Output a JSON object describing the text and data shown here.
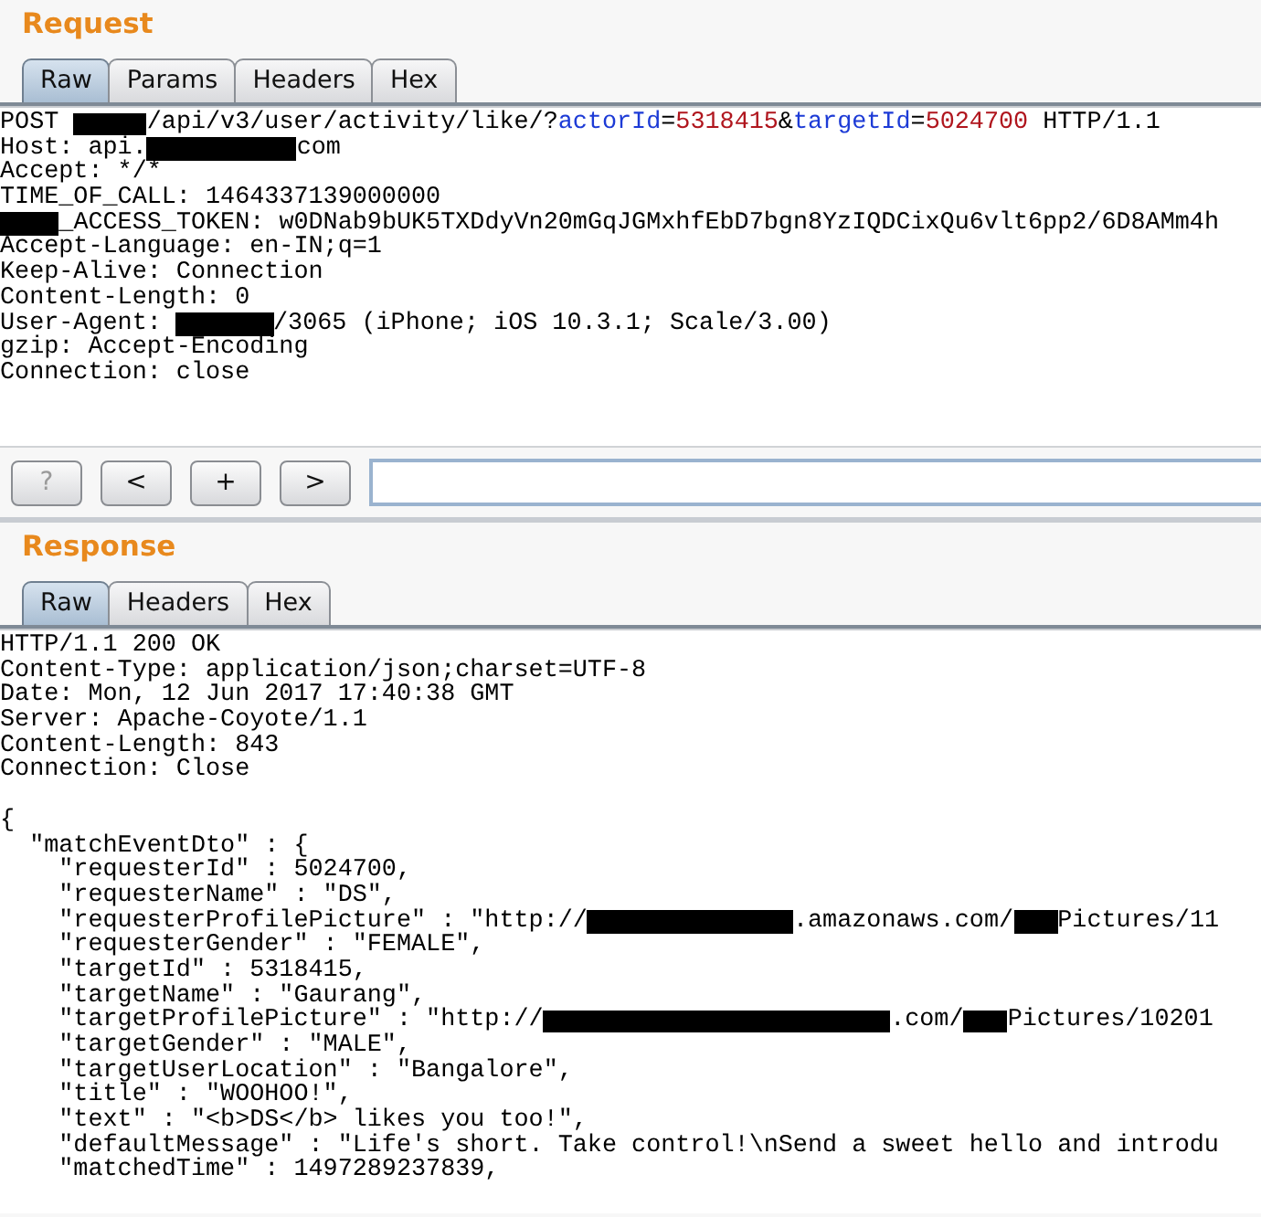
{
  "request": {
    "title": "Request",
    "tabs": [
      {
        "label": "Raw",
        "selected": true
      },
      {
        "label": "Params",
        "selected": false
      },
      {
        "label": "Headers",
        "selected": false
      },
      {
        "label": "Hex",
        "selected": false
      }
    ],
    "lines": [
      [
        {
          "kind": "plain",
          "text": "POST "
        },
        {
          "kind": "mask_m"
        },
        {
          "kind": "plain",
          "text": "/api/v3/user/activity/like/?"
        },
        {
          "kind": "param",
          "text": "actorId"
        },
        {
          "kind": "plain",
          "text": "="
        },
        {
          "kind": "value",
          "text": "5318415"
        },
        {
          "kind": "plain",
          "text": "&"
        },
        {
          "kind": "param",
          "text": "targetId"
        },
        {
          "kind": "plain",
          "text": "="
        },
        {
          "kind": "value",
          "text": "5024700"
        },
        {
          "kind": "plain",
          "text": " HTTP/1.1"
        }
      ],
      [
        {
          "kind": "plain",
          "text": "Host: api."
        },
        {
          "kind": "mask_l"
        },
        {
          "kind": "plain",
          "text": "com"
        }
      ],
      [
        {
          "kind": "plain",
          "text": "Accept: */*"
        }
      ],
      [
        {
          "kind": "plain",
          "text": "TIME_OF_CALL: 1464337139000000"
        }
      ],
      [
        {
          "kind": "mask_s"
        },
        {
          "kind": "plain",
          "text": "_ACCESS_TOKEN: w0DNab9bUK5TXDdyVn20mGqJGMxhfEbD7bgn8YzIQDCixQu6vlt6pp2/6D8AMm4h"
        }
      ],
      [
        {
          "kind": "plain",
          "text": "Accept-Language: en-IN;q=1"
        }
      ],
      [
        {
          "kind": "plain",
          "text": "Keep-Alive: Connection"
        }
      ],
      [
        {
          "kind": "plain",
          "text": "Content-Length: 0"
        }
      ],
      [
        {
          "kind": "plain",
          "text": "User-Agent: "
        },
        {
          "kind": "mask_ml"
        },
        {
          "kind": "plain",
          "text": "/3065 (iPhone; iOS 10.3.1; Scale/3.00)"
        }
      ],
      [
        {
          "kind": "plain",
          "text": "gzip: Accept-Encoding"
        }
      ],
      [
        {
          "kind": "plain",
          "text": "Connection: close"
        }
      ]
    ]
  },
  "toolbar": {
    "buttons": [
      {
        "label": "?",
        "disabled": true
      },
      {
        "label": "<",
        "disabled": false
      },
      {
        "label": "+",
        "disabled": false
      },
      {
        "label": ">",
        "disabled": false
      }
    ]
  },
  "response": {
    "title": "Response",
    "tabs": [
      {
        "label": "Raw",
        "selected": true
      },
      {
        "label": "Headers",
        "selected": false
      },
      {
        "label": "Hex",
        "selected": false
      }
    ],
    "lines": [
      [
        {
          "kind": "plain",
          "text": "HTTP/1.1 200 OK"
        }
      ],
      [
        {
          "kind": "plain",
          "text": "Content-Type: application/json;charset=UTF-8"
        }
      ],
      [
        {
          "kind": "plain",
          "text": "Date: Mon, 12 Jun 2017 17:40:38 GMT"
        }
      ],
      [
        {
          "kind": "plain",
          "text": "Server: Apache-Coyote/1.1"
        }
      ],
      [
        {
          "kind": "plain",
          "text": "Content-Length: 843"
        }
      ],
      [
        {
          "kind": "plain",
          "text": "Connection: Close"
        }
      ],
      [
        {
          "kind": "blank"
        }
      ],
      [
        {
          "kind": "plain",
          "text": "{"
        }
      ],
      [
        {
          "kind": "plain",
          "text": "  \"matchEventDto\" : {"
        }
      ],
      [
        {
          "kind": "plain",
          "text": "    \"requesterId\" : 5024700,"
        }
      ],
      [
        {
          "kind": "plain",
          "text": "    \"requesterName\" : \"DS\","
        }
      ],
      [
        {
          "kind": "plain",
          "text": "    \"requesterProfilePicture\" : \"http://"
        },
        {
          "kind": "mask_xl"
        },
        {
          "kind": "plain",
          "text": ".amazonaws.com/"
        },
        {
          "kind": "mask_xs"
        },
        {
          "kind": "plain",
          "text": "Pictures/11"
        }
      ],
      [
        {
          "kind": "plain",
          "text": "    \"requesterGender\" : \"FEMALE\","
        }
      ],
      [
        {
          "kind": "plain",
          "text": "    \"targetId\" : 5318415,"
        }
      ],
      [
        {
          "kind": "plain",
          "text": "    \"targetName\" : \"Gaurang\","
        }
      ],
      [
        {
          "kind": "plain",
          "text": "    \"targetProfilePicture\" : \"http://"
        },
        {
          "kind": "mask_xxl"
        },
        {
          "kind": "plain",
          "text": ".com/"
        },
        {
          "kind": "mask_xs"
        },
        {
          "kind": "plain",
          "text": "Pictures/10201"
        }
      ],
      [
        {
          "kind": "plain",
          "text": "    \"targetGender\" : \"MALE\","
        }
      ],
      [
        {
          "kind": "plain",
          "text": "    \"targetUserLocation\" : \"Bangalore\","
        }
      ],
      [
        {
          "kind": "plain",
          "text": "    \"title\" : \"WOOHOO!\","
        }
      ],
      [
        {
          "kind": "plain",
          "text": "    \"text\" : \"<b>DS</b> likes you too!\","
        }
      ],
      [
        {
          "kind": "plain",
          "text": "    \"defaultMessage\" : \"Life's short. Take control!\\nSend a sweet hello and introdu"
        }
      ],
      [
        {
          "kind": "plain",
          "text": "    \"matchedTime\" : 1497289237839,"
        }
      ]
    ]
  }
}
